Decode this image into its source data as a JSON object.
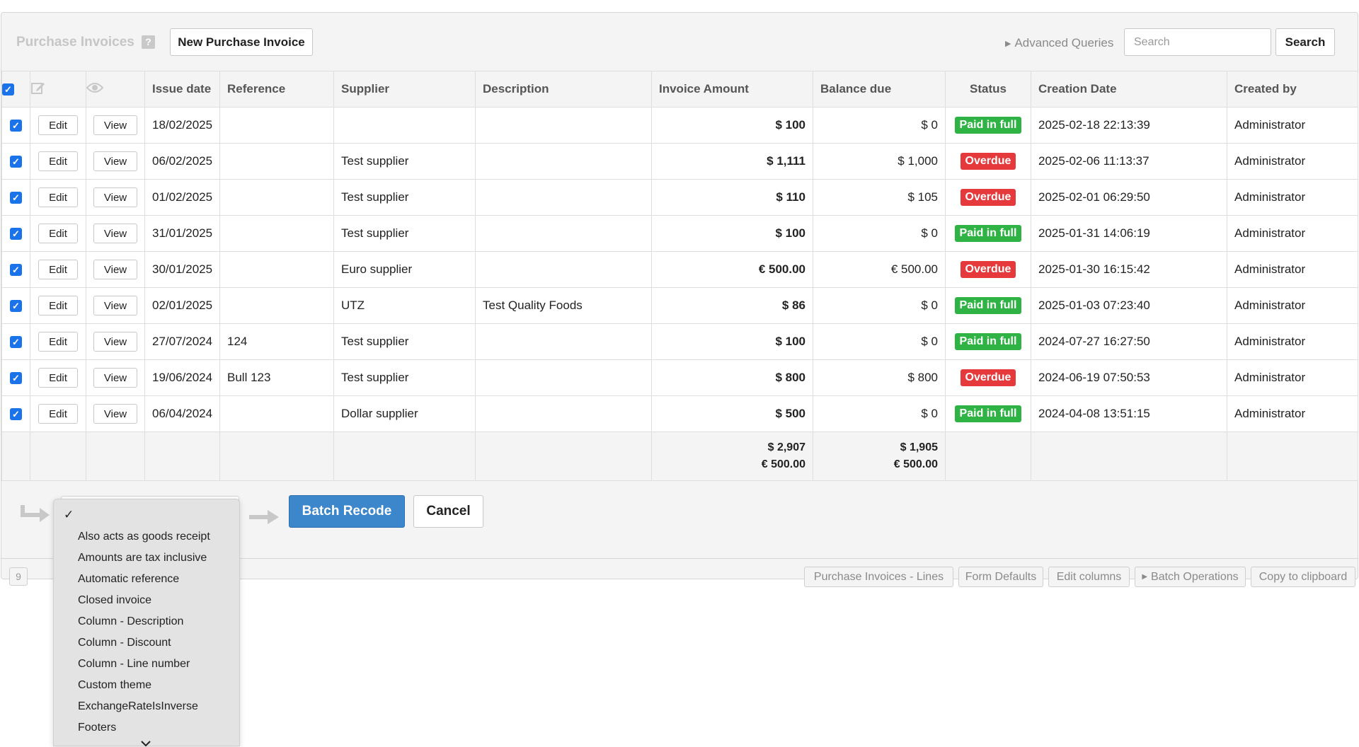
{
  "header": {
    "title": "Purchase Invoices",
    "help_icon": "?",
    "new_button": "New Purchase Invoice",
    "advanced_queries": "Advanced Queries",
    "search_placeholder": "Search",
    "search_button": "Search"
  },
  "table": {
    "columns": {
      "issue_date": "Issue date",
      "reference": "Reference",
      "supplier": "Supplier",
      "description": "Description",
      "invoice_amount": "Invoice Amount",
      "balance_due": "Balance due",
      "status": "Status",
      "creation_date": "Creation Date",
      "created_by": "Created by"
    },
    "edit_label": "Edit",
    "view_label": "View",
    "rows": [
      {
        "issue_date": "18/02/2025",
        "reference": "",
        "supplier": "",
        "description": "",
        "amount": "$ 100",
        "balance": "$ 0",
        "status": "Paid in full",
        "status_color": "#2fb344",
        "created": "2025-02-18 22:13:39",
        "by": "Administrator"
      },
      {
        "issue_date": "06/02/2025",
        "reference": "",
        "supplier": "Test supplier",
        "description": "",
        "amount": "$ 1,111",
        "balance": "$ 1,000",
        "status": "Overdue",
        "status_color": "#e5393b",
        "created": "2025-02-06 11:13:37",
        "by": "Administrator"
      },
      {
        "issue_date": "01/02/2025",
        "reference": "",
        "supplier": "Test supplier",
        "description": "",
        "amount": "$ 110",
        "balance": "$ 105",
        "status": "Overdue",
        "status_color": "#e5393b",
        "created": "2025-02-01 06:29:50",
        "by": "Administrator"
      },
      {
        "issue_date": "31/01/2025",
        "reference": "",
        "supplier": "Test supplier",
        "description": "",
        "amount": "$ 100",
        "balance": "$ 0",
        "status": "Paid in full",
        "status_color": "#2fb344",
        "created": "2025-01-31 14:06:19",
        "by": "Administrator"
      },
      {
        "issue_date": "30/01/2025",
        "reference": "",
        "supplier": "Euro supplier",
        "description": "",
        "amount": "€ 500.00",
        "balance": "€ 500.00",
        "status": "Overdue",
        "status_color": "#e5393b",
        "created": "2025-01-30 16:15:42",
        "by": "Administrator"
      },
      {
        "issue_date": "02/01/2025",
        "reference": "",
        "supplier": "UTZ",
        "description": "Test Quality Foods",
        "amount": "$ 86",
        "balance": "$ 0",
        "status": "Paid in full",
        "status_color": "#2fb344",
        "created": "2025-01-03 07:23:40",
        "by": "Administrator"
      },
      {
        "issue_date": "27/07/2024",
        "reference": "124",
        "supplier": "Test supplier",
        "description": "",
        "amount": "$ 100",
        "balance": "$ 0",
        "status": "Paid in full",
        "status_color": "#2fb344",
        "created": "2024-07-27 16:27:50",
        "by": "Administrator"
      },
      {
        "issue_date": "19/06/2024",
        "reference": "Bull 123",
        "supplier": "Test supplier",
        "description": "",
        "amount": "$ 800",
        "balance": "$ 800",
        "status": "Overdue",
        "status_color": "#e5393b",
        "created": "2024-06-19 07:50:53",
        "by": "Administrator"
      },
      {
        "issue_date": "06/04/2024",
        "reference": "",
        "supplier": "Dollar supplier",
        "description": "",
        "amount": "$ 500",
        "balance": "$ 0",
        "status": "Paid in full",
        "status_color": "#2fb344",
        "created": "2024-04-08 13:51:15",
        "by": "Administrator"
      }
    ],
    "totals": {
      "amount_usd": "$ 2,907",
      "amount_eur": "€ 500.00",
      "balance_usd": "$ 1,905",
      "balance_eur": "€ 500.00"
    }
  },
  "batch": {
    "recode_button": "Batch Recode",
    "cancel_button": "Cancel"
  },
  "dropdown": {
    "check": "✓",
    "options": [
      "Also acts as goods receipt",
      "Amounts are tax inclusive",
      "Automatic reference",
      "Closed invoice",
      "Column - Description",
      "Column - Discount",
      "Column - Line number",
      "Custom theme",
      "ExchangeRateIsInverse",
      "Footers"
    ]
  },
  "footer": {
    "count": "9",
    "buttons": {
      "lines": "Purchase Invoices - Lines",
      "form_defaults": "Form Defaults",
      "edit_columns": "Edit columns",
      "batch_operations": "Batch Operations",
      "copy_clipboard": "Copy to clipboard"
    }
  },
  "icons": {
    "header_checkbox": "checkbox-checked-icon",
    "edit_column": "pencil-square-icon",
    "view_column": "eye-icon",
    "batch_left": "arrow-curve-icon",
    "batch_right": "arrow-right-icon",
    "advanced_toggle": "triangle-right-icon",
    "dropdown_more": "chevron-down-icon"
  }
}
